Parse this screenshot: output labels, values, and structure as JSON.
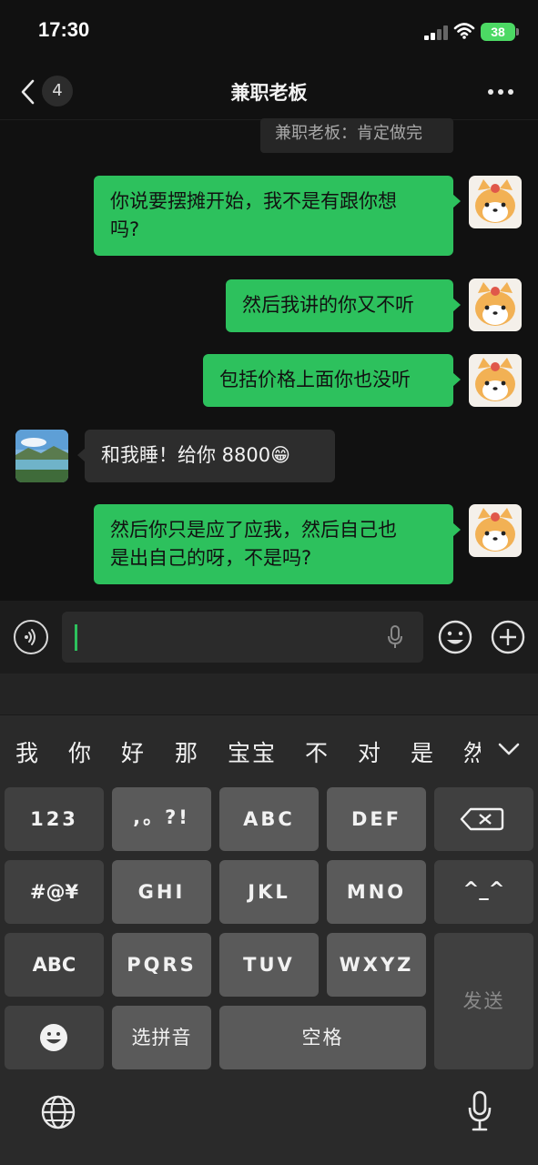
{
  "status": {
    "time": "17:30",
    "battery": "38"
  },
  "nav": {
    "unread_count": "4",
    "title": "兼职老板"
  },
  "quote": "兼职老板：肯定做完",
  "messages": [
    {
      "from": "me",
      "lines": [
        "你说要摆摊开始，我不是有跟你想",
        "吗?"
      ]
    },
    {
      "from": "me",
      "lines": [
        "然后我讲的你又不听"
      ]
    },
    {
      "from": "me",
      "lines": [
        "包括价格上面你也没听"
      ]
    },
    {
      "from": "them",
      "lines": [
        "和我睡！给你 8800😁"
      ]
    },
    {
      "from": "me",
      "lines": [
        "然后你只是应了应我，然后自己也",
        "是出自己的呀，不是吗?"
      ]
    }
  ],
  "candidates": [
    "我",
    "你",
    "好",
    "那",
    "宝宝",
    "不",
    "对",
    "是",
    "然"
  ],
  "keys": {
    "num": "123",
    "punct": ",。?!",
    "abc2": "ABC",
    "def": "DEF",
    "sym": "#@¥",
    "ghi": "GHI",
    "jkl": "JKL",
    "mno": "MNO",
    "kaomoji": "^_^",
    "abc_switch": "ABC",
    "pqrs": "PQRS",
    "tuv": "TUV",
    "wxyz": "WXYZ",
    "send": "发送",
    "pinyin": "选拼音",
    "space": "空格"
  },
  "icons": [
    "back-chevron-icon",
    "more-icon",
    "voice-icon",
    "mic-icon",
    "emoji-icon",
    "plus-icon",
    "backspace-icon",
    "chevron-down-icon",
    "globe-icon",
    "dictation-mic-icon"
  ],
  "colors": {
    "my_bubble": "#2dc15d",
    "their_bubble": "#2d2d2d",
    "background": "#111111"
  }
}
